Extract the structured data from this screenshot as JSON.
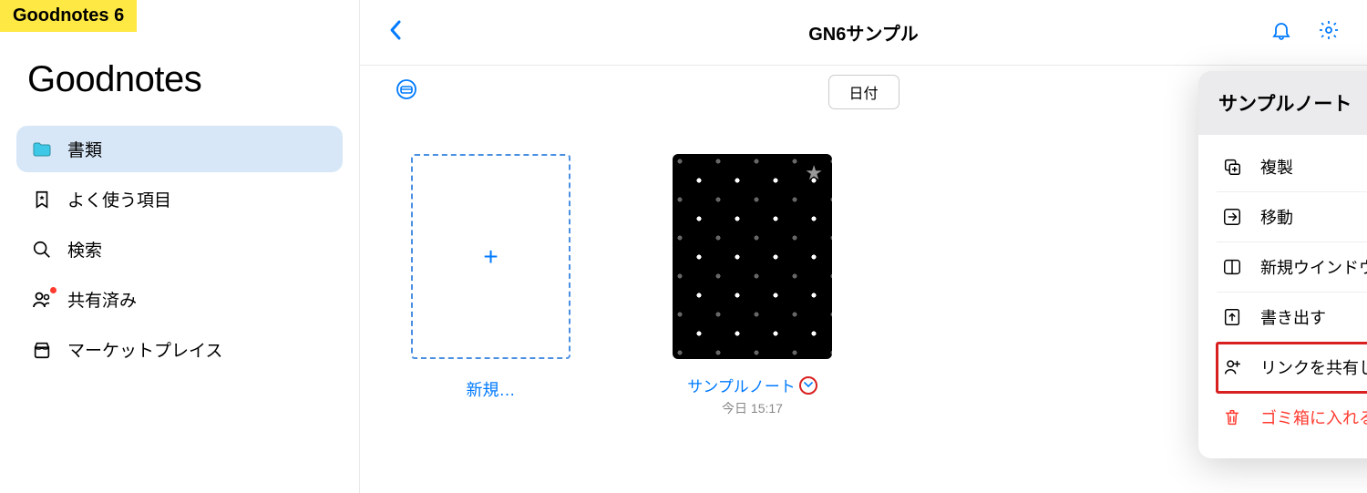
{
  "app_badge": "Goodnotes 6",
  "logo": "Goodnotes",
  "sidebar": {
    "items": [
      {
        "label": "書類"
      },
      {
        "label": "よく使う項目"
      },
      {
        "label": "検索"
      },
      {
        "label": "共有済み"
      },
      {
        "label": "マーケットプレイス"
      }
    ]
  },
  "header": {
    "title": "GN6サンプル"
  },
  "toolbar": {
    "sort_label": "日付"
  },
  "grid": {
    "new_label": "新規…",
    "note": {
      "title": "サンプルノート",
      "date": "今日 15:17"
    }
  },
  "popover": {
    "title": "サンプルノート",
    "items": [
      {
        "label": "複製"
      },
      {
        "label": "移動"
      },
      {
        "label": "新規ウインドウで開く"
      },
      {
        "label": "書き出す"
      },
      {
        "label": "リンクを共有して共同作業"
      },
      {
        "label": "ゴミ箱に入れる"
      }
    ]
  }
}
